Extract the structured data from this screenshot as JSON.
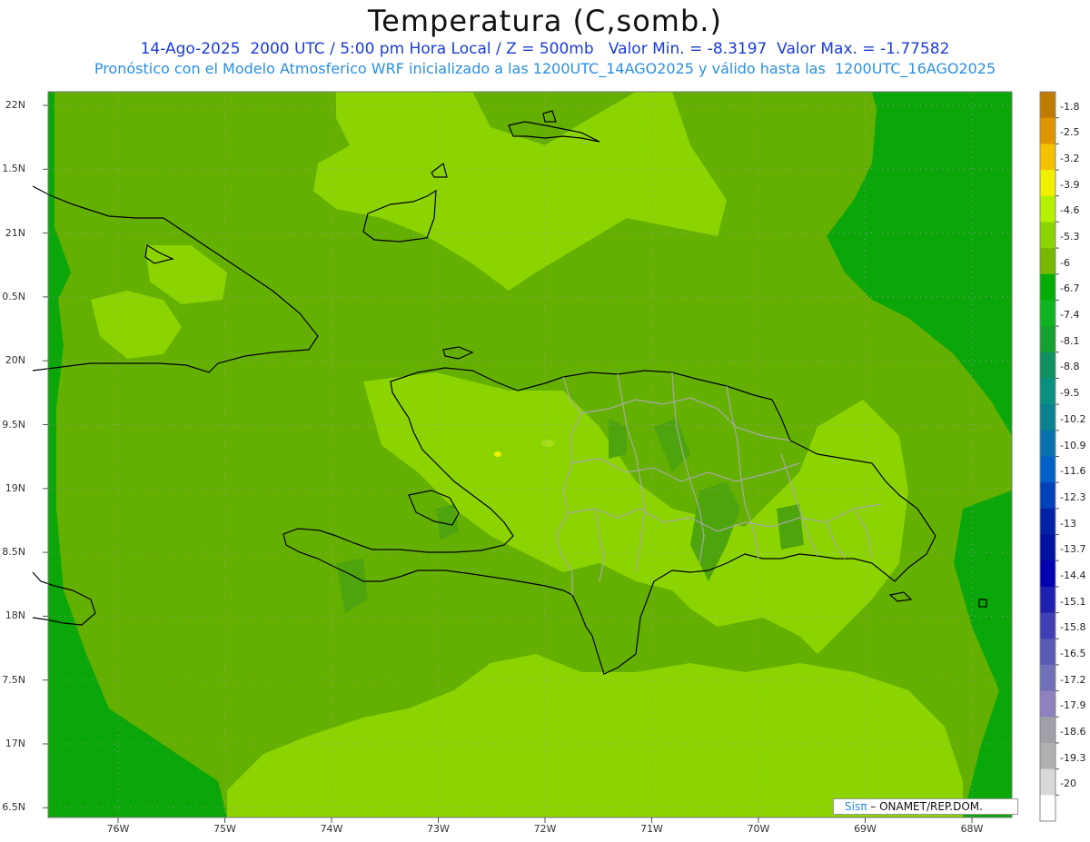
{
  "title": "Temperatura (C,somb.)",
  "subtitle_1": "14-Ago-2025  2000 UTC / 5:00 pm Hora Local / Z = 500mb   Valor Min. = -8.3197  Valor Max. = -1.77582",
  "subtitle_2": "Pronóstico con el Modelo Atmosferico WRF inicializado a las 1200UTC_14AGO2025 y válido hasta las  1200UTC_16AGO2025",
  "lat_labels": [
    "22N",
    "1.5N",
    "21N",
    "0.5N",
    "20N",
    "9.5N",
    "19N",
    "8.5N",
    "18N",
    "7.5N",
    "17N",
    "6.5N"
  ],
  "lon_labels": [
    "76W",
    "75W",
    "74W",
    "73W",
    "72W",
    "71W",
    "70W",
    "69W",
    "68W"
  ],
  "colorbar": {
    "labels": [
      "-1.8",
      "-2.5",
      "-3.2",
      "-3.9",
      "-4.6",
      "-5.3",
      "-6",
      "-6.7",
      "-7.4",
      "-8.1",
      "-8.8",
      "-9.5",
      "-10.2",
      "-10.9",
      "-11.6",
      "-12.3",
      "-13",
      "-13.7",
      "-14.4",
      "-15.1",
      "-15.8",
      "-16.5",
      "-17.2",
      "-17.9",
      "-18.6",
      "-19.3",
      "-20"
    ],
    "colors": [
      "#c07a00",
      "#e09500",
      "#f5c000",
      "#f0f000",
      "#b4f000",
      "#8cd400",
      "#78b800",
      "#06ac06",
      "#10b420",
      "#16a030",
      "#109060",
      "#0a9080",
      "#0a8090",
      "#0a70b0",
      "#0060c8",
      "#0040b8",
      "#0020a8",
      "#0010a0",
      "#0000b0",
      "#2020b0",
      "#4040b4",
      "#5a5ab8",
      "#7070b8",
      "#8f80c0",
      "#a0a0a8",
      "#b0b0b0",
      "#d8d8d8",
      "#ffffff"
    ]
  },
  "map_colors": {
    "base": "#64b000",
    "light": "#8cd400",
    "lighter": "#a6dc1a",
    "dark": "#0aa60a",
    "mid": "#4ea40c",
    "yellow": "#f0f000",
    "coast": "#000000",
    "border": "#a8a8a8"
  },
  "credit": {
    "sis": "Sisπ",
    "text": " – ONAMET/REP.DOM."
  }
}
